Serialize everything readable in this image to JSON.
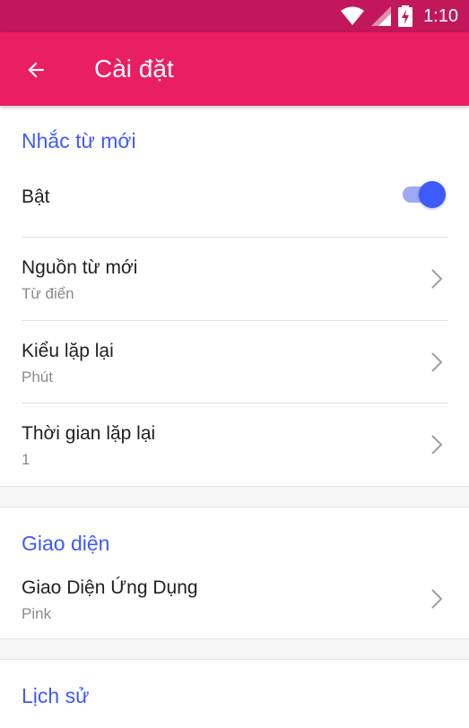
{
  "status_bar": {
    "time": "1:10",
    "icons": [
      "wifi-icon",
      "signal-icon",
      "battery-charging-icon"
    ]
  },
  "app_bar": {
    "back_icon": "arrow-back-icon",
    "title": "Cài đặt"
  },
  "colors": {
    "status_bar": "#c2185b",
    "app_bar": "#e91e63",
    "accent": "#3d5afe"
  },
  "sections": [
    {
      "header": "Nhắc từ mới",
      "items": [
        {
          "title": "Bật",
          "control": "toggle",
          "checked": true
        },
        {
          "title": "Nguồn từ mới",
          "summary": "Từ điển"
        },
        {
          "title": "Kiểu lặp lại",
          "summary": "Phút"
        },
        {
          "title": "Thời gian lặp lại",
          "summary": "1"
        }
      ]
    },
    {
      "header": "Giao diện",
      "items": [
        {
          "title": "Giao Diện Ứng Dụng",
          "summary": "Pink"
        }
      ]
    },
    {
      "header": "Lịch sử",
      "items": []
    }
  ]
}
